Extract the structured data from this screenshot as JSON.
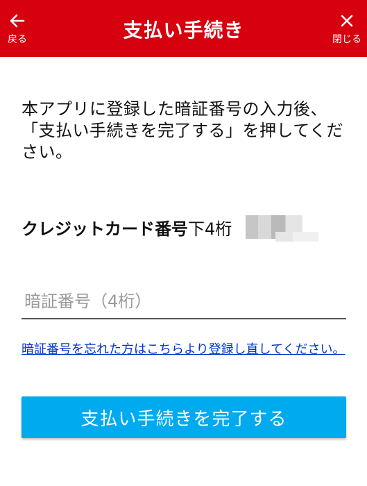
{
  "header": {
    "back_label": "戻る",
    "title": "支払い手続き",
    "close_label": "閉じる",
    "background_color": "#d7000f"
  },
  "instructions": "本アプリに登録した暗証番号の入力後、「支払い手続きを完了する」を押してください。",
  "card": {
    "label": "クレジットカード番号",
    "suffix": "下4桁"
  },
  "pin": {
    "placeholder": "暗証番号（4桁）",
    "value": ""
  },
  "forgot_link": "暗証番号を忘れた方はこちらより登録し直してください。",
  "submit_label": "支払い手続きを完了する",
  "accent_color": "#00aaee"
}
